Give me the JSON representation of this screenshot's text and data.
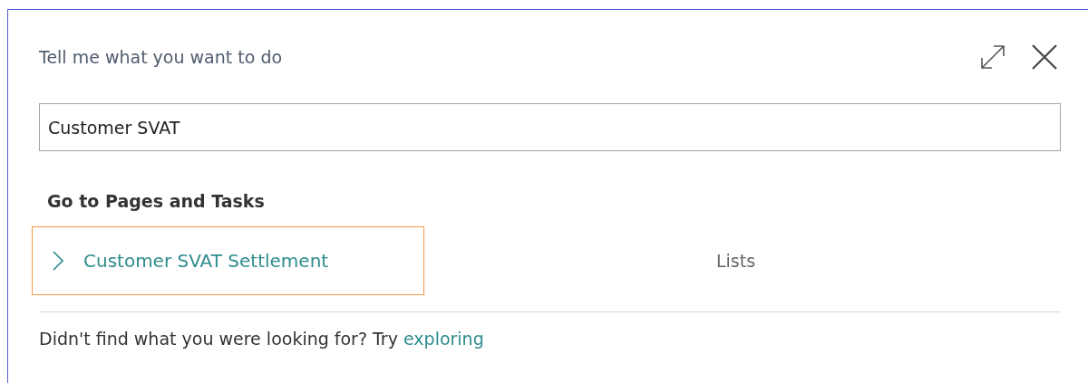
{
  "dialog": {
    "title": "Tell me what you want to do"
  },
  "search": {
    "value": "Customer SVAT"
  },
  "section": {
    "heading": "Go to Pages and Tasks"
  },
  "results": [
    {
      "name": "Customer SVAT Settlement",
      "category": "Lists",
      "selected": true
    }
  ],
  "footer": {
    "text": "Didn't find what you were looking for? Try",
    "link": "exploring"
  }
}
